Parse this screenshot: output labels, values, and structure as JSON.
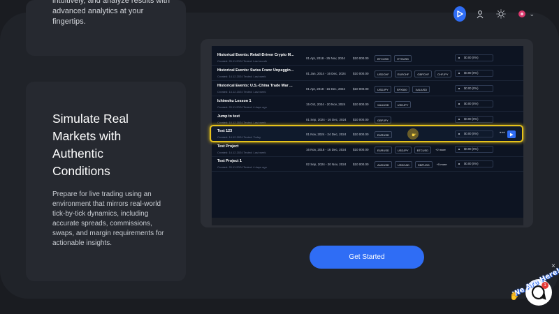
{
  "intro_card": {
    "text": "intuitively, and analyze results with advanced analytics at your fingertips."
  },
  "feature_card": {
    "title": "Simulate Real Markets with Authentic Conditions",
    "description": "Prepare for live trading using an environment that mirrors real-world tick-by-tick dynamics, including accurate spreads, commissions, swaps, and margin requirements for actionable insights."
  },
  "top_controls": {
    "icons": [
      "play-icon",
      "user-icon",
      "sun-icon",
      "flag-icon"
    ],
    "chevron": "⌄"
  },
  "projects_table": {
    "rows": [
      {
        "name": "Historical Events: Retail-Driven Crypto M...",
        "meta": "Created: 26.11.2024  Tested: Last month",
        "dates": "01 Apr, 2018 - 25 Nov, 2024",
        "amount": "$10 000.00",
        "symbols": [
          "BTCUSD",
          "ETHUSD"
        ],
        "more": "",
        "pnl": "$0.00 (0%)"
      },
      {
        "name": "Historical Events: Swiss Franc Unpeggin...",
        "meta": "Created: 14.12.2024  Tested: Last week",
        "dates": "01 Jan, 2014 - 16 Dec, 2024",
        "amount": "$10 000.00",
        "symbols": [
          "USDCHF",
          "EURCHF",
          "GBPCHF",
          "CHFJPY"
        ],
        "more": "",
        "pnl": "$0.00 (0%)"
      },
      {
        "name": "Historical Events: U.S.-China Trade War ...",
        "meta": "Created: 14.12.2024  Tested: Last week",
        "dates": "01 Apr, 2018 - 16 Dec, 2024",
        "amount": "$10 000.00",
        "symbols": [
          "USDJPY",
          "SPX500",
          "XAUUSD"
        ],
        "more": "",
        "pnl": "$0.00 (0%)"
      },
      {
        "name": "Ichimoku Lesson 1",
        "meta": "Created: 20.11.2024  Tested: 4 days ago",
        "dates": "15 Oct, 2024 - 20 Nov, 2024",
        "amount": "$10 000.00",
        "symbols": [
          "XAUUSD",
          "USDJPY"
        ],
        "more": "",
        "pnl": "$0.00 (0%)"
      },
      {
        "name": "Jump to test",
        "meta": "Created: 10.12.2024  Tested: Last week",
        "dates": "01 Sep, 2024 - 16 Dec, 2024",
        "amount": "$10 000.00",
        "symbols": [
          "GBPJPY"
        ],
        "more": "",
        "pnl": "$0.00 (0%)"
      },
      {
        "name": "Test 123",
        "meta": "Created: 14.12.2024  Tested: Today",
        "dates": "01 Nov, 2024 - 24 Dec, 2024",
        "amount": "$10 000.00",
        "symbols": [
          "EURUSD"
        ],
        "more": "",
        "pnl": "$0.00 (0%)"
      },
      {
        "name": "Test Project",
        "meta": "Created: 14.12.2024  Tested: Last week",
        "dates": "16 Nov, 2018 - 16 Dec, 2024",
        "amount": "$10 000.00",
        "symbols": [
          "EURUSD",
          "USDJPY",
          "BTCUSD"
        ],
        "more": "+2 more",
        "pnl": "$0.00 (0%)"
      },
      {
        "name": "Test Project 1",
        "meta": "Created: 20.11.2024  Tested: 4 days ago",
        "dates": "02 Sep, 2024 - 20 Nov, 2024",
        "amount": "$10 000.00",
        "symbols": [
          "AUDUSD",
          "USDCAD",
          "GBPUSD"
        ],
        "more": "+5 more",
        "pnl": "$0.00 (0%)"
      }
    ],
    "active_row_index": 5,
    "row_menu": "•••"
  },
  "cta": {
    "label": "Get Started"
  },
  "chat": {
    "label": "We Are Here!",
    "badge": "1",
    "close": "×",
    "colors": {
      "accent": "#2f6df5"
    }
  },
  "colors": {
    "background": "#1a1c21",
    "accent": "#2f6df5",
    "highlight": "#e6c21a"
  }
}
